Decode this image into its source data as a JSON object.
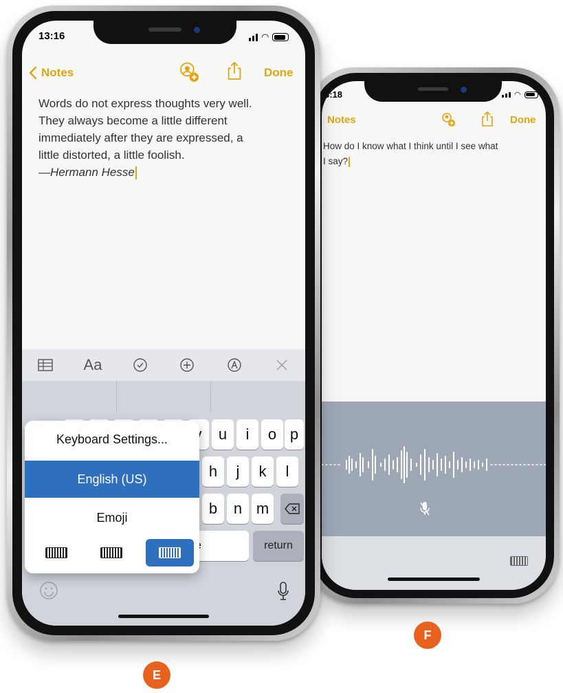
{
  "left_phone": {
    "status_time": "13:16",
    "nav": {
      "back_label": "Notes",
      "done_label": "Done"
    },
    "note": {
      "lines": [
        "Words do not express thoughts very well.",
        "They always become a little different",
        "immediately after they are expressed, a",
        "little distorted, a little foolish."
      ],
      "attribution": "—Hermann Hesse"
    },
    "toolbar": {
      "format_label": "Aa"
    },
    "keys": {
      "row1": [
        "y",
        "u",
        "i",
        "o",
        "p"
      ],
      "row2": [
        "h",
        "j",
        "k",
        "l"
      ],
      "row3": [
        "b",
        "n",
        "m"
      ],
      "space_fragment": "e",
      "return_label": "return"
    },
    "popup": {
      "items": [
        "Keyboard Settings...",
        "English (US)",
        "Emoji"
      ],
      "selected": "English (US)"
    }
  },
  "right_phone": {
    "status_time": "3:18",
    "nav": {
      "back_label": "Notes",
      "done_label": "Done"
    },
    "note": {
      "lines": [
        "How do I know what I think until I see what",
        "I say?"
      ]
    }
  },
  "badges": {
    "left": "E",
    "right": "F"
  },
  "colors": {
    "accent": "#e3a414",
    "selection": "#2e6fbe",
    "badge": "#e8621f",
    "dictation_bg": "#9ea7b5"
  },
  "icons": [
    "back-chevron-icon",
    "add-person-icon",
    "share-icon",
    "table-icon",
    "checklist-icon",
    "add-icon",
    "markup-icon",
    "close-icon",
    "emoji-icon",
    "microphone-icon",
    "keyboard-icon",
    "delete-icon"
  ]
}
